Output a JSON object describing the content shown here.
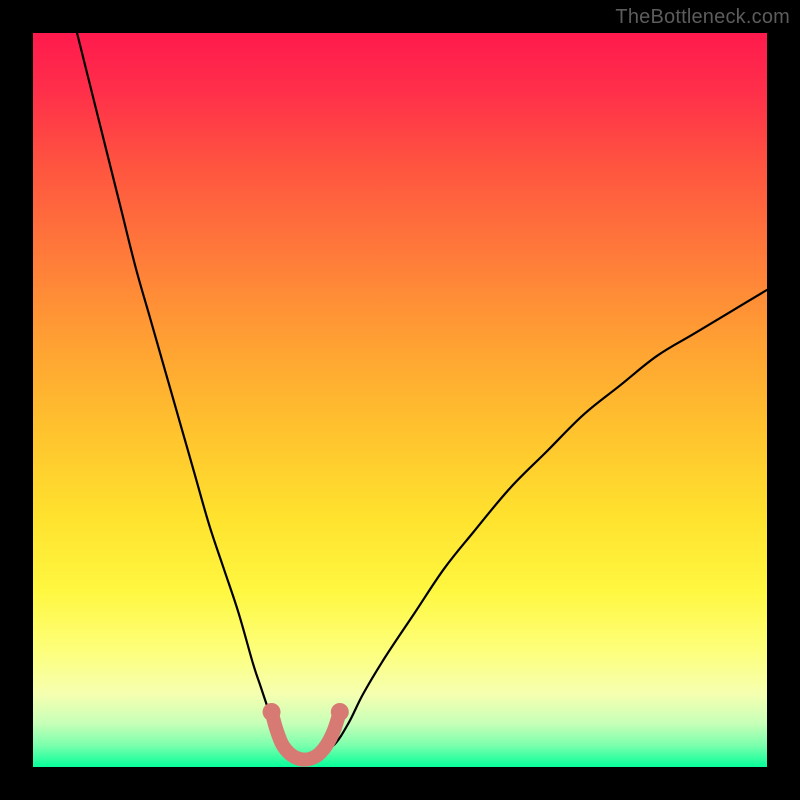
{
  "watermark": {
    "text": "TheBottleneck.com"
  },
  "chart_data": {
    "type": "line",
    "title": "",
    "xlabel": "",
    "ylabel": "",
    "xlim": [
      0,
      100
    ],
    "ylim": [
      0,
      100
    ],
    "grid": false,
    "series": [
      {
        "name": "bottleneck-curve",
        "color": "#000000",
        "x": [
          6,
          8,
          10,
          12,
          14,
          16,
          18,
          20,
          22,
          24,
          26,
          28,
          30,
          31,
          32,
          33,
          34,
          35,
          36,
          37,
          38,
          39,
          41,
          43,
          45,
          48,
          52,
          56,
          60,
          65,
          70,
          75,
          80,
          85,
          90,
          95,
          100
        ],
        "values": [
          100,
          92,
          84,
          76,
          68,
          61,
          54,
          47,
          40,
          33,
          27,
          21,
          14,
          11,
          8,
          5,
          3,
          2,
          1,
          1,
          1,
          2,
          3,
          6,
          10,
          15,
          21,
          27,
          32,
          38,
          43,
          48,
          52,
          56,
          59,
          62,
          65
        ]
      },
      {
        "name": "optimal-trough",
        "color": "#d87a74",
        "x": [
          32.5,
          33.2,
          34.0,
          35.0,
          36.0,
          37.0,
          38.0,
          39.0,
          40.0,
          41.0,
          41.8
        ],
        "values": [
          7.5,
          5.0,
          3.0,
          1.8,
          1.2,
          1.0,
          1.2,
          1.8,
          3.0,
          5.0,
          7.5
        ]
      }
    ],
    "markers": [
      {
        "x": 32.5,
        "y": 7.5,
        "color": "#d87a74"
      },
      {
        "x": 41.8,
        "y": 7.5,
        "color": "#d87a74"
      }
    ],
    "background_gradient": {
      "type": "vertical",
      "stops": [
        {
          "pos": 0.0,
          "color": "#ff1a4d"
        },
        {
          "pos": 0.3,
          "color": "#ff7a3a"
        },
        {
          "pos": 0.6,
          "color": "#ffd82e"
        },
        {
          "pos": 0.85,
          "color": "#fdff7a"
        },
        {
          "pos": 1.0,
          "color": "#06ff9a"
        }
      ]
    }
  }
}
